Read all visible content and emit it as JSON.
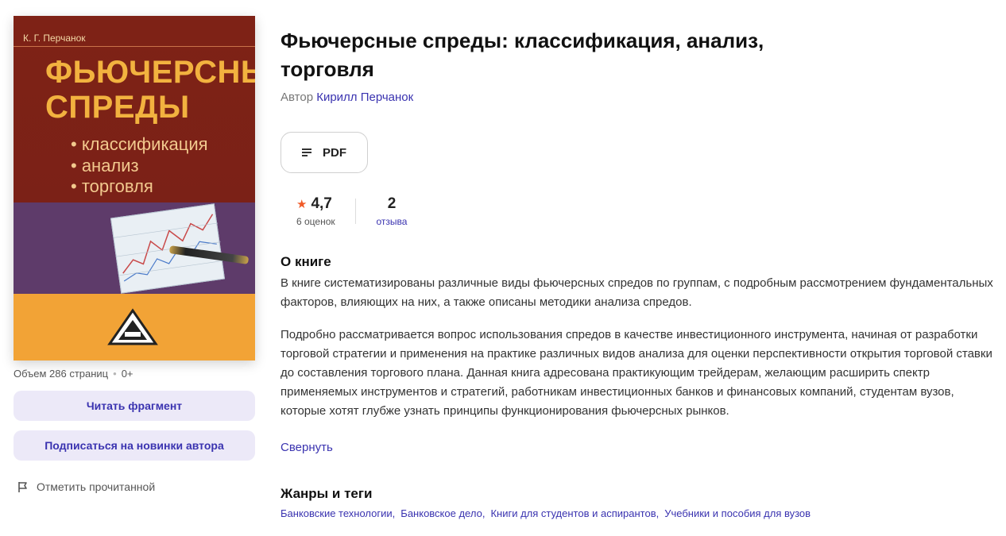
{
  "cover": {
    "author": "К. Г. Перчанок",
    "title_line1": "ФЬЮЧЕРСНЫЕ",
    "title_line2": "СПРЕДЫ",
    "bullets": [
      "• классификация",
      "• анализ",
      "• торговля"
    ]
  },
  "meta": {
    "volume": "Объем 286 страниц",
    "age": "0+"
  },
  "sidebar": {
    "read_fragment": "Читать фрагмент",
    "subscribe": "Подписаться на новинки автора",
    "mark_read": "Отметить прочитанной"
  },
  "book": {
    "title": "Фьючерсные спреды: классификация, анализ, торговля",
    "author_label": "Автор",
    "author_name": "Кирилл Перчанок",
    "format": "PDF"
  },
  "stats": {
    "rating": "4,7",
    "ratings_count": "6 оценок",
    "reviews": "2",
    "reviews_label": "отзыва"
  },
  "about": {
    "heading": "О книге",
    "paragraph1": "В книге систематизированы различные виды фьючерсных спредов по группам, с подробным рассмотрением фундаментальных факторов, влияющих на них, а также описаны методики анализа спредов.",
    "paragraph2": "Подробно рассматривается вопрос использования спредов в качестве инвестиционного инструмента, начиная от разработки торговой стратегии и применения на практике различных видов анализа для оценки перспективности открытия торговой ставки до составления торгового плана. Данная книга адресована практикующим трейдерам, желающим расширить спектр применяемых инструментов и стратегий, работникам инвестиционных банков и финансовых компаний, студентам вузов, которые хотят глубже узнать принципы функционирования фьючерсных рынков.",
    "collapse": "Свернуть"
  },
  "genres": {
    "heading": "Жанры и теги",
    "tags": [
      "Банковские технологии",
      "Банковское дело",
      "Книги для студентов и аспирантов",
      "Учебники и пособия для вузов"
    ]
  },
  "colors": {
    "accent": "#3a33b0",
    "button_bg": "#ece9f8",
    "star": "#f05a28"
  }
}
